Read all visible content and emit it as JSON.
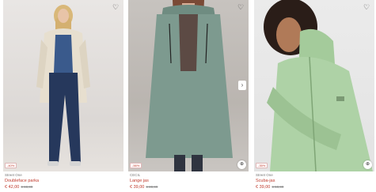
{
  "products": [
    {
      "brand": "Street One",
      "name": "Doubleface parka",
      "price": "€ 42,00",
      "old_price": "€ 69,99",
      "discount": "-40%"
    },
    {
      "brand": "CECIL",
      "name": "Lange jas",
      "price": "€ 39,00",
      "old_price": "€ 89,99",
      "discount": "-56%"
    },
    {
      "brand": "Street One",
      "name": "Scuba-jas",
      "price": "€ 39,00",
      "old_price": "€ 59,99",
      "discount": "-35%"
    }
  ],
  "icons": {
    "wishlist": "heart-icon",
    "add_to_cart": "bag-icon",
    "next_image": "chevron-right-icon"
  },
  "colors": {
    "sale_red": "#c0392b",
    "jacket_beige": "#e7dfcf",
    "coat_green": "#7d9a8f",
    "scuba_mint": "#aed2a6"
  }
}
